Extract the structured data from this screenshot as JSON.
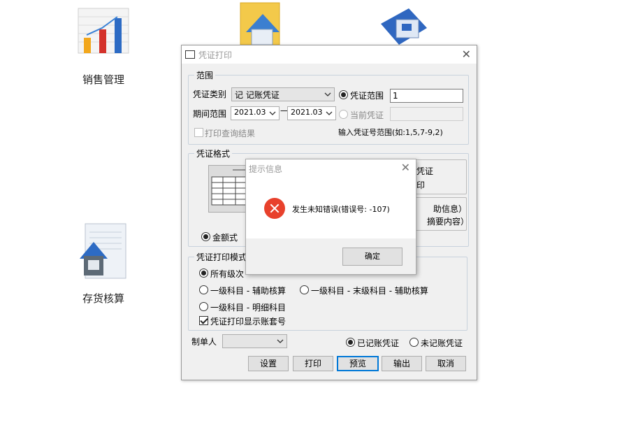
{
  "desktop": {
    "icons": [
      {
        "label": "销售管理"
      },
      {
        "label": ""
      },
      {
        "label": ""
      },
      {
        "label": "存货核算"
      }
    ]
  },
  "dialog": {
    "title": "凭证打印",
    "range_group": {
      "title": "范围",
      "voucher_type_label": "凭证类别",
      "voucher_type_value": "记 记账凭证",
      "period_label": "期间范围",
      "period_from": "2021.03",
      "period_to": "2021.03",
      "voucher_range_label": "凭证范围",
      "voucher_range_value": "1",
      "current_voucher_label": "当前凭证",
      "print_query_label": "打印查询结果",
      "hint": "输入凭证号范围(如:1,5,7-9,2)"
    },
    "format_group": {
      "title": "凭证格式",
      "opt1_line1": "凭证",
      "opt1_line2": "印",
      "opt2_line1": "助信息）",
      "opt2_line2": "摘要内容）",
      "amount_style_label": "金额式"
    },
    "mode_group": {
      "title": "凭证打印模式",
      "all_levels": "所有级次",
      "first_aux": "一级科目 - 辅助核算",
      "first_last_aux": "一级科目 - 末级科目 - 辅助核算",
      "first_detail": "一级科目 - 明细科目",
      "show_account_set": "凭证打印显示账套号"
    },
    "maker_label": "制单人",
    "posted_label": "已记账凭证",
    "unposted_label": "未记账凭证",
    "buttons": {
      "settings": "设置",
      "print": "打印",
      "preview": "预览",
      "export": "输出",
      "cancel": "取消"
    }
  },
  "popup": {
    "title": "提示信息",
    "message": "发生未知错误(错误号: -107)",
    "ok": "确定"
  },
  "colors": {
    "error": "#e8412c",
    "focus": "#0078d7",
    "dialog_bg": "#f0f0f0"
  }
}
